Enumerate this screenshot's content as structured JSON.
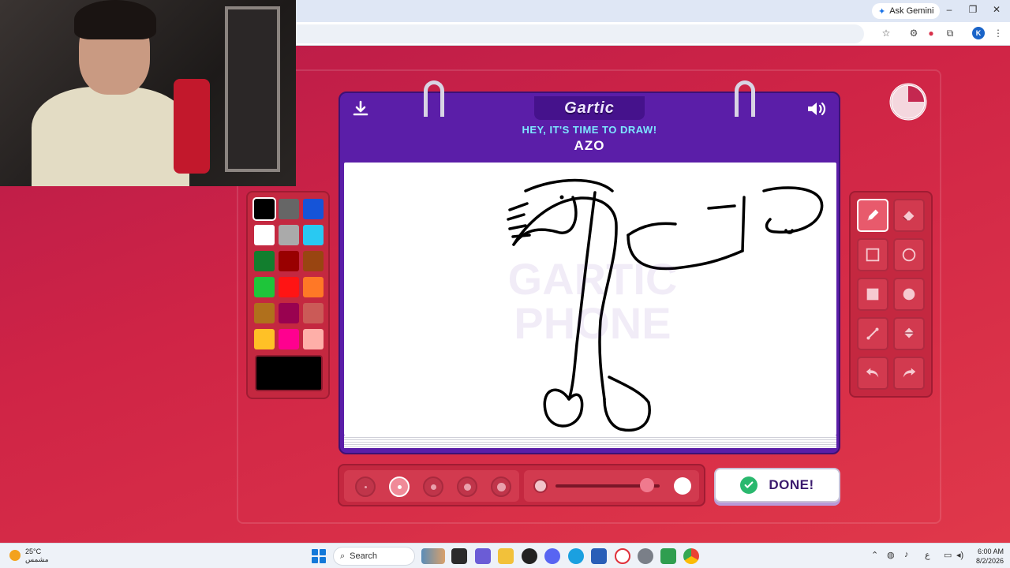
{
  "browser": {
    "gemini_label": "Ask Gemini",
    "profile_initial": "K"
  },
  "game": {
    "logo": "Gartic",
    "instruction": "HEY, IT'S TIME TO DRAW!",
    "word": "AZO",
    "done_label": "DONE!",
    "palette": [
      "#000000",
      "#666666",
      "#1554d8",
      "#ffffff",
      "#aaaaaa",
      "#29c9f2",
      "#127e2e",
      "#990000",
      "#994511",
      "#1ec53a",
      "#ff1414",
      "#ff7826",
      "#b0701c",
      "#990250",
      "#cb5a57",
      "#ffc126",
      "#ff008f",
      "#feafa8"
    ],
    "selected_color": "#000000",
    "tools": [
      "pencil",
      "eraser",
      "rectangle-outline",
      "ellipse-outline",
      "rectangle-filled",
      "ellipse-filled",
      "line",
      "fill-bucket",
      "undo",
      "redo"
    ],
    "active_tool": "pencil",
    "brush_sizes": 5,
    "active_brush_size": 2,
    "opacity_level": 0.88,
    "timer_remaining_fraction": 0.75
  },
  "taskbar": {
    "temperature": "25°C",
    "weather_desc": "مشمس",
    "search_label": "Search",
    "time": "6:00 AM",
    "date": "8/2/2026",
    "lang": "ع"
  }
}
